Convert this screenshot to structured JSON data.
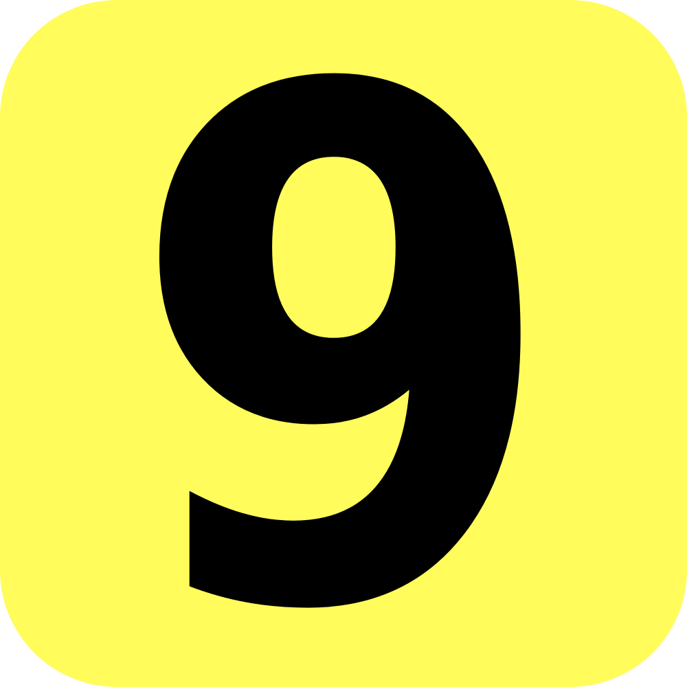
{
  "badge": {
    "numeral": "9",
    "background_color": "#FFFC5C",
    "numeral_color": "#000000"
  }
}
